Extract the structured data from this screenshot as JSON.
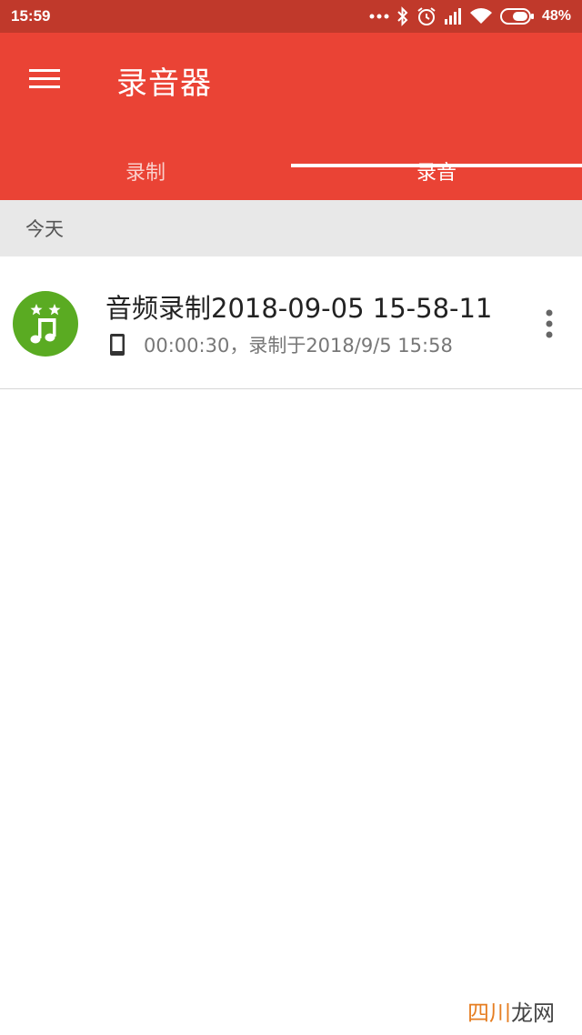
{
  "status_bar": {
    "time": "15:59",
    "battery": "48%",
    "icons": [
      "more-dots-icon",
      "bluetooth-icon",
      "alarm-icon",
      "signal-icon",
      "wifi-icon",
      "battery-icon"
    ]
  },
  "app_bar": {
    "title": "录音器",
    "menu_icon": "hamburger-menu-icon",
    "tabs": [
      {
        "label": "录制",
        "active": false
      },
      {
        "label": "录音",
        "active": true
      }
    ]
  },
  "section": {
    "label": "今天"
  },
  "recordings": [
    {
      "title": "音频录制2018-09-05 15-58-11",
      "meta": "00:00:30，录制于2018/9/5 15:58",
      "icon": "music-note-icon",
      "source_icon": "phone-icon",
      "more_icon": "more-vert-icon"
    }
  ],
  "watermark": {
    "part1": "四川",
    "part2": "龙网"
  },
  "colors": {
    "status_bar": "#c0392b",
    "app_bar": "#ea4335",
    "avatar": "#5aab22",
    "section_bg": "#e8e8e8"
  }
}
